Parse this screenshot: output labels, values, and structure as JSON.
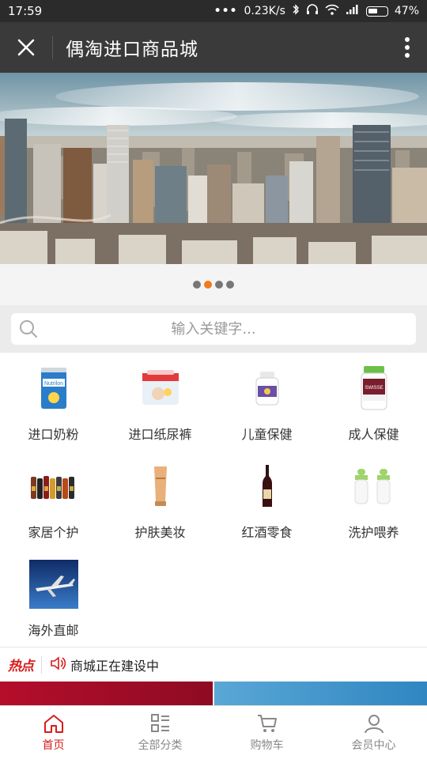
{
  "status_bar": {
    "time": "17:59",
    "speed": "0.23K/s",
    "battery": "47%"
  },
  "header": {
    "title": "偶淘进口商品城"
  },
  "carousel": {
    "slide_count": 4,
    "active_index": 1,
    "colors": {
      "active": "#f07a1f",
      "inactive": "#777777"
    }
  },
  "search": {
    "placeholder": "输入关键字..."
  },
  "categories": [
    {
      "label": "进口奶粉",
      "icon": "milk-powder-can"
    },
    {
      "label": "进口纸尿裤",
      "icon": "diaper-pack"
    },
    {
      "label": "儿童保健",
      "icon": "supplement-bottle"
    },
    {
      "label": "成人保健",
      "icon": "health-jar"
    },
    {
      "label": "家居个护",
      "icon": "bottles-row"
    },
    {
      "label": "护肤美妆",
      "icon": "cosmetic-tube"
    },
    {
      "label": "红酒零食",
      "icon": "wine-bottle"
    },
    {
      "label": "洗护喂养",
      "icon": "baby-bottles"
    },
    {
      "label": "海外直邮",
      "icon": "airplane"
    }
  ],
  "hot": {
    "badge": "热点",
    "text": "商城正在建设中"
  },
  "bottom_nav": [
    {
      "label": "首页",
      "icon": "home-icon",
      "active": true
    },
    {
      "label": "全部分类",
      "icon": "category-list-icon",
      "active": false
    },
    {
      "label": "购物车",
      "icon": "cart-icon",
      "active": false
    },
    {
      "label": "会员中心",
      "icon": "user-icon",
      "active": false
    }
  ],
  "colors": {
    "accent": "#d71c1c",
    "titlebar": "#3a3a3a",
    "statusbar": "#2b2b2b"
  }
}
